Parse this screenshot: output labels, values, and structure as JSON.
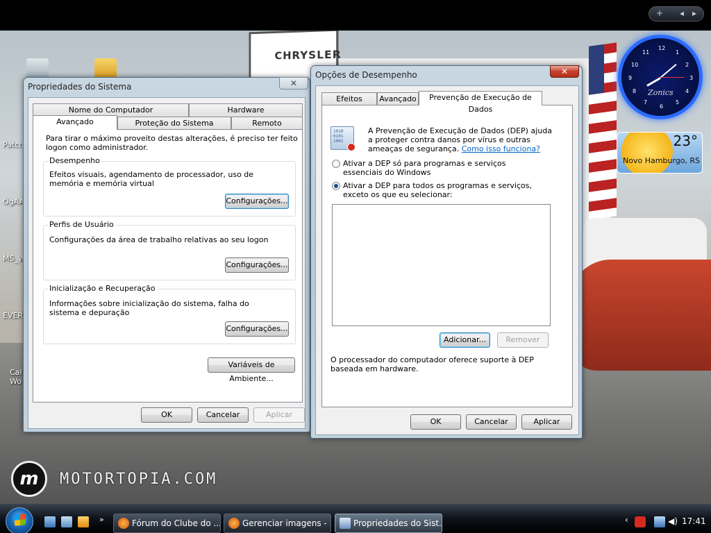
{
  "desktop": {
    "sign_text": "CHRYSLER",
    "watermark": "MOTORTOPIA.COM",
    "icons": [
      "Patch",
      "OgAA",
      "MS_W",
      "EVER",
      "Cal Wo"
    ]
  },
  "gadgets": {
    "clock_brand": "Zonics",
    "clock_numbers": [
      "12",
      "1",
      "2",
      "3",
      "4",
      "5",
      "6",
      "7",
      "8",
      "9",
      "10",
      "11"
    ],
    "weather_temp": "23°",
    "weather_city": "Novo Hamburgo, RS"
  },
  "sysprops": {
    "title": "Propriedades do Sistema",
    "tabs_row1": [
      "Nome do Computador",
      "Hardware"
    ],
    "tabs_row2": [
      "Avançado",
      "Proteção do Sistema",
      "Remoto"
    ],
    "intro": "Para tirar o máximo proveito destas alterações, é preciso ter feito logon como administrador.",
    "perf_legend": "Desempenho",
    "perf_text": "Efeitos visuais, agendamento de processador, uso de memória e memória virtual",
    "profiles_legend": "Perfis de Usuário",
    "profiles_text": "Configurações da área de trabalho relativas ao seu logon",
    "startup_legend": "Inicialização e Recuperação",
    "startup_text": "Informações sobre inicialização do sistema, falha do sistema e depuração",
    "settings_label": "Configurações...",
    "env_vars_label": "Variáveis de Ambiente...",
    "ok": "OK",
    "cancel": "Cancelar",
    "apply": "Aplicar"
  },
  "perfopts": {
    "title": "Opções de Desempenho",
    "tabs": [
      "Efeitos Visuais",
      "Avançado",
      "Prevenção de Execução de Dados"
    ],
    "dep_desc": "A Prevenção de Execução de Dados (DEP) ajuda a proteger contra danos por vírus e outras ameaças de segurança.",
    "dep_link": "Como isso funciona?",
    "radio1": "Ativar a DEP só para programas e serviços essenciais do Windows",
    "radio2": "Ativar a DEP para todos os programas e serviços, exceto os que eu selecionar:",
    "selected_radio": 2,
    "add": "Adicionar...",
    "remove": "Remover",
    "support_text": "O processador do computador oferece suporte à DEP baseada em hardware.",
    "ok": "OK",
    "cancel": "Cancelar",
    "apply": "Aplicar"
  },
  "taskbar": {
    "tasks": [
      "Fórum do Clube do ...",
      "Gerenciar imagens - ...",
      "Propriedades do Sist..."
    ],
    "active_task": 2,
    "time": "17:41"
  }
}
